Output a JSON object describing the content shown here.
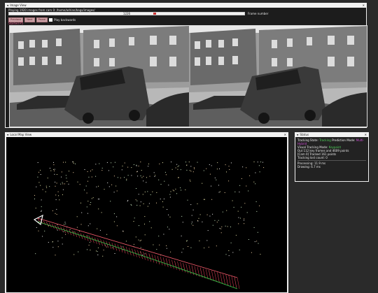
{
  "image_view": {
    "title": "Image View",
    "playing_text": "Playing 1920 images from cam 0: /home/adrian/bags/images/",
    "frame_value": "1226",
    "frame_progress": 0.62,
    "frame_label": "Frame number",
    "buttons": {
      "previous": "Previous",
      "next": "Next",
      "pause": "Pause"
    },
    "play_backwards_label": "Play backwards",
    "status_tag": "Started P5"
  },
  "local_map": {
    "title": "Local Map View"
  },
  "status": {
    "title": "Status",
    "tracking_state_label": "Tracking State:",
    "tracking_state_value": "Tracking",
    "prediction_mode_label": "Prediction Mode:",
    "prediction_mode_value": "Multi-Hybrid",
    "visual_tracking_mode_label": "Visual Tracking Mode:",
    "visual_tracking_mode_value": "Keypoint",
    "keyframes_line": "Out 112 key frames and 4609 points",
    "tracked_line": "[Cam 0] Tracked 161 points",
    "tracking_lost_line": "Tracking lost count: 0",
    "processing_line": "Processing: 11.9 ms",
    "drawing_line": "Drawing: 6.7 ms",
    "colors": {
      "tracking": "#4fd15a",
      "prediction": "#d04fd6",
      "visual": "#4fd15a"
    }
  }
}
